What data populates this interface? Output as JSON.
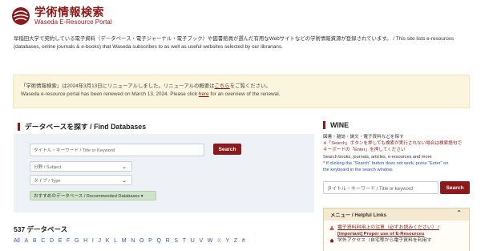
{
  "header": {
    "logo_title": "学術情報検索",
    "logo_subtitle": "Waseda E-Resource Portal"
  },
  "intro": {
    "line1": "早稲田大学で契約している電子資料（データベース・電子ジャーナル・電子ブック）や図書館員が選んだ有用なWebサイトなどの学術情報資源が登録されています。 / This site lists e-resources",
    "line2": "(databases, online journals & e-books) that Waseda subscribes to as well as useful websites selected by our librarians."
  },
  "notice": {
    "jp_prefix": "「学術情報検索」は2024年3月13日にリニューアルしました。リニューアルの概要は",
    "jp_link": "こちら",
    "jp_suffix": "をご覧ください。",
    "en_prefix": "Waseda e-resource portal has been renewed on March 13, 2024. Please click ",
    "en_link": "here",
    "en_suffix": " for an overview of the renewal."
  },
  "databases": {
    "section_title": "データベースを探す / Find Databases",
    "keyword_placeholder": "タイトル・キーワード / Title or Keyword",
    "search_label": "Search",
    "subject_label": "分野 / Subject",
    "type_label": "タイプ / Type",
    "recommended_label": "おすすめのデータベース / Recommended Databases ▾",
    "count_label": "537 データベース",
    "letters": [
      "All",
      "A",
      "B",
      "C",
      "D",
      "E",
      "F",
      "G",
      "H",
      "I",
      "J",
      "K",
      "L",
      "M",
      "N",
      "O",
      "P",
      "Q",
      "R",
      "S",
      "T",
      "U",
      "V",
      "W",
      "X",
      "Y",
      "Z",
      "#"
    ]
  },
  "wine": {
    "section_title": "WINE",
    "desc_jp": "図書・雑誌・論文・電子資料などを探す",
    "note_jp": "※「Search」ボタンを押しても検索が実行されない場合は検索語句で",
    "note_jp2": "キーボードの「Enter」を押してください",
    "desc_en": "Search books, journals, articles, e-resources and more",
    "note_en": "* If clicking the \"Search\" button does not work, press \"Enter\" on",
    "note_en2": "the keyboard in the search window.",
    "keyword_placeholder": "タイトル・キーワード / Title or keyword",
    "search_label": "Search"
  },
  "menu": {
    "title": "メニュー / Helpful Links",
    "item1_jp": "電子資料利用上の注意（必ずお読みください） /",
    "item1_en": "[Important] Proper use of E-Resources",
    "item2": "学外アクセス（自宅等から電子資料を利用す"
  },
  "colors": {
    "brand": "#8b1a1a",
    "link": "#2a56c6",
    "notice_bg": "#fcf5dd",
    "panel_bg": "#eef1f5",
    "recommended_bg": "#cfe3c9"
  }
}
